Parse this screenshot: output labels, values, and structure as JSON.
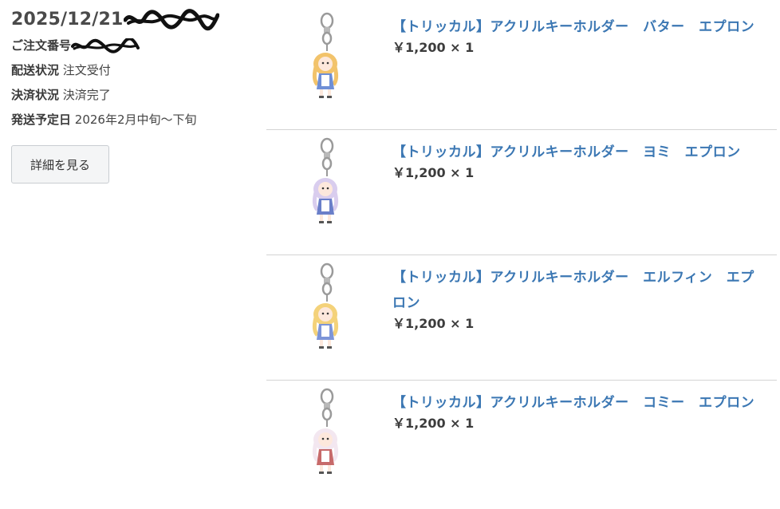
{
  "order": {
    "date": "2025/12/21",
    "number_label": "ご注文番号",
    "shipping_status_label": "配送状況",
    "shipping_status_value": "注文受付",
    "payment_status_label": "決済状況",
    "payment_status_value": "決済完了",
    "ship_date_label": "発送予定日",
    "ship_date_value": "2026年2月中旬〜下旬",
    "detail_button": "詳細を見る"
  },
  "items": [
    {
      "title": "【トリッカル】アクリルキーホルダー　バター　エプロン",
      "price": "￥1,200 × 1",
      "hair": "#f2c36b",
      "dress": "#6f8fd6"
    },
    {
      "title": "【トリッカル】アクリルキーホルダー　ヨミ　エプロン",
      "price": "￥1,200 × 1",
      "hair": "#d9cdee",
      "dress": "#6a7fc9"
    },
    {
      "title": "【トリッカル】アクリルキーホルダー　エルフィン　エプロン",
      "price": "￥1,200 × 1",
      "hair": "#f4d27a",
      "dress": "#7d95d8"
    },
    {
      "title": "【トリッカル】アクリルキーホルダー　コミー　エプロン",
      "price": "￥1,200 × 1",
      "hair": "#f3e7f0",
      "dress": "#c76a6a"
    }
  ],
  "colors": {
    "link": "#3b77b3",
    "divider": "#d4d4d4"
  }
}
